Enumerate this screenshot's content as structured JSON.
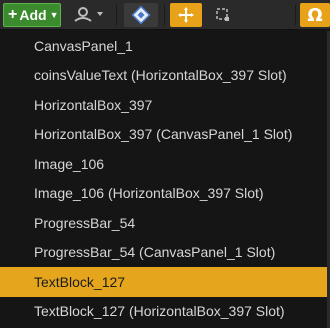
{
  "toolbar": {
    "add_label": "Add",
    "icons": [
      "plus-icon",
      "widget-dropdown-icon",
      "diamond-icon",
      "move-anchor-icon",
      "select-frame-icon",
      "omega-icon"
    ]
  },
  "menu": {
    "items": [
      {
        "label": "CanvasPanel_1",
        "selected": false
      },
      {
        "label": "coinsValueText (HorizontalBox_397 Slot)",
        "selected": false
      },
      {
        "label": "HorizontalBox_397",
        "selected": false
      },
      {
        "label": "HorizontalBox_397 (CanvasPanel_1 Slot)",
        "selected": false
      },
      {
        "label": "Image_106",
        "selected": false
      },
      {
        "label": "Image_106 (HorizontalBox_397 Slot)",
        "selected": false
      },
      {
        "label": "ProgressBar_54",
        "selected": false
      },
      {
        "label": "ProgressBar_54 (CanvasPanel_1 Slot)",
        "selected": false
      },
      {
        "label": "TextBlock_127",
        "selected": true
      },
      {
        "label": "TextBlock_127 (HorizontalBox_397 Slot)",
        "selected": false
      }
    ]
  },
  "colors": {
    "accent": "#e5a51d",
    "add_green": "#3b8a2e",
    "background": "#151515",
    "text": "#d6d6d6"
  }
}
